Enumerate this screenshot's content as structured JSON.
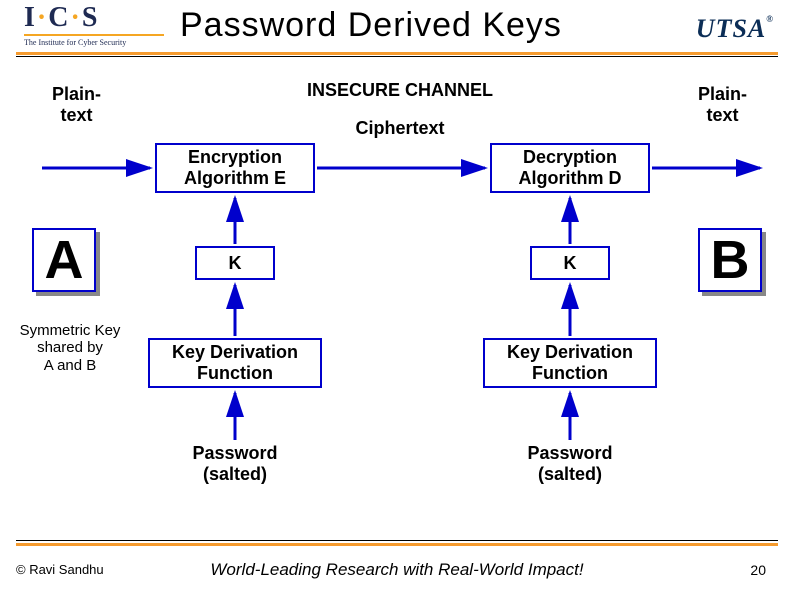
{
  "title": "Password Derived Keys",
  "logos": {
    "ics_line": "I",
    "ics_sub": "The Institute for Cyber Security",
    "utsa": "UTSA"
  },
  "labels": {
    "insecure": "INSECURE CHANNEL",
    "ciphertext": "Ciphertext",
    "plaintext_left": "Plain-\ntext",
    "plaintext_right": "Plain-\ntext",
    "encryption": "Encryption\nAlgorithm E",
    "decryption": "Decryption\nAlgorithm D",
    "k_left": "K",
    "k_right": "K",
    "kdf_left": "Key Derivation\nFunction",
    "kdf_right": "Key Derivation\nFunction",
    "pw_left": "Password\n(salted)",
    "pw_right": "Password\n(salted)",
    "A": "A",
    "B": "B",
    "shared": "Symmetric Key\nshared by\nA and B"
  },
  "footer": {
    "copyright": "© Ravi  Sandhu",
    "tagline": "World-Leading Research with Real-World Impact!",
    "page": "20"
  }
}
